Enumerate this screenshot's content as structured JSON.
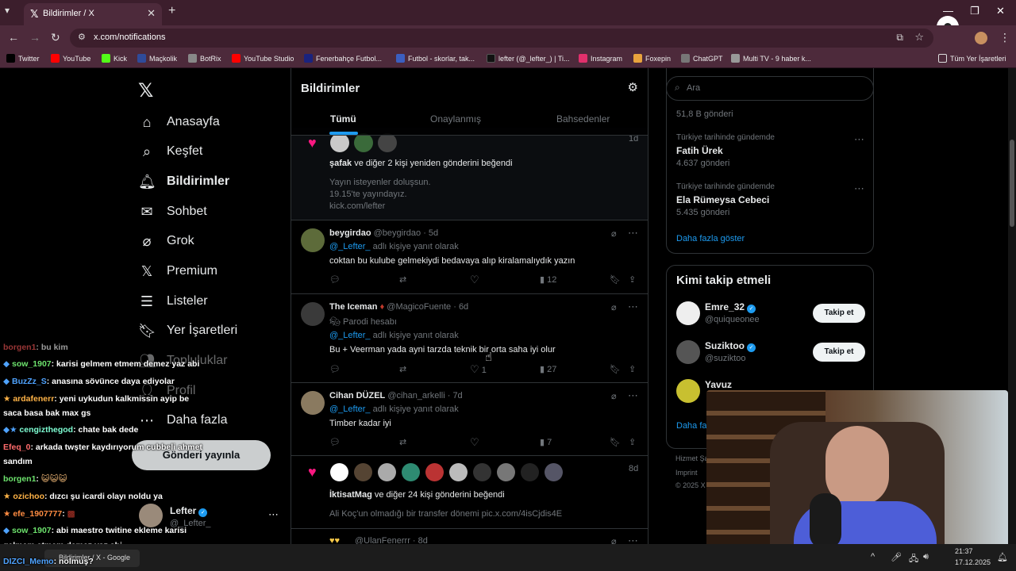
{
  "browser": {
    "tab_title": "Bildirimler / X",
    "url": "x.com/notifications",
    "bookmarks": [
      "Twitter",
      "YouTube",
      "Kick",
      "Maçkolik",
      "BotRix",
      "YouTube Studio",
      "Fenerbahçe Futbol...",
      "Futbol - skorlar, tak...",
      "lefter (@_lefter_) | Ti...",
      "Instagram",
      "Foxepin",
      "ChatGPT",
      "Multi TV - 9 haber k..."
    ],
    "all_bookmarks": "Tüm Yer İşaretleri"
  },
  "nav": {
    "items": [
      {
        "label": "Anasayfa",
        "icon": "home-icon"
      },
      {
        "label": "Keşfet",
        "icon": "search-icon"
      },
      {
        "label": "Bildirimler",
        "icon": "bell-icon"
      },
      {
        "label": "Sohbet",
        "icon": "mail-icon"
      },
      {
        "label": "Grok",
        "icon": "grok-icon"
      },
      {
        "label": "Premium",
        "icon": "x-icon"
      },
      {
        "label": "Listeler",
        "icon": "list-icon"
      },
      {
        "label": "Yer İşaretleri",
        "icon": "bookmark-icon"
      },
      {
        "label": "Topluluklar",
        "icon": "people-icon"
      },
      {
        "label": "Profil",
        "icon": "user-icon"
      },
      {
        "label": "Daha fazla",
        "icon": "more-icon"
      }
    ],
    "post_button": "Gönderi yayınla",
    "account_name": "Lefter",
    "account_handle": "@_Lefter_"
  },
  "header": {
    "title": "Bildirimler",
    "tabs": [
      "Tümü",
      "Onaylanmış",
      "Bahsedenler"
    ]
  },
  "notifications": {
    "n1": {
      "time": "1d",
      "text_user": "şafak",
      "text_rest": " ve diğer 2 kişi yeniden gönderini beğendi",
      "preview1": "Yayın isteyenler doluşsun.",
      "preview2": "19.15'te yayındayız.",
      "preview3": "kick.com/lefter"
    },
    "n2": {
      "name": "beygirdao",
      "handle": "@beygirdao",
      "time": "· 5d",
      "reply_to": "@_Lefter_",
      "reply_suffix": " adlı kişiye yanıt olarak",
      "body": "coktan bu kulube gelmekiydi bedavaya alıp kiralamalıydık yazın",
      "views": "12"
    },
    "n3": {
      "name": "The Iceman",
      "handle": "@MagicoFuente",
      "time": "· 6d",
      "parody": "Parodi hesabı",
      "reply_to": "@_Lefter_",
      "reply_suffix": " adlı kişiye yanıt olarak",
      "body": "Bu + Veerman yada ayni tarzda teknik bir orta saha iyi olur",
      "likes": "1",
      "views": "27"
    },
    "n4": {
      "name": "Cihan DÜZEL",
      "handle": "@cihan_arkelli",
      "time": "· 7d",
      "reply_to": "@_Lefter_",
      "reply_suffix": " adlı kişiye yanıt olarak",
      "body": "Timber kadar iyi",
      "views": "7"
    },
    "n5": {
      "time": "8d",
      "text_user": "İktisatMag",
      "text_rest": " ve diğer 24 kişi gönderini beğendi",
      "preview": "Ali Koç'un olmadığı bir transfer dönemi pic.x.com/4isCjdis4E"
    },
    "n6": {
      "handle": "@UlanFenerrr",
      "time": "· 8d"
    }
  },
  "search": {
    "placeholder": "Ara"
  },
  "trends": {
    "top_count": "51,8 B gönderi",
    "items": [
      {
        "context": "Türkiye tarihinde gündemde",
        "name": "Fatih Ürek",
        "count": "4.637 gönderi"
      },
      {
        "context": "Türkiye tarihinde gündemde",
        "name": "Ela Rümeysa Cebeci",
        "count": "5.435 gönderi"
      }
    ],
    "show_more": "Daha fazla göster"
  },
  "who_to_follow": {
    "title": "Kimi takip etmeli",
    "users": [
      {
        "name": "Emre_32",
        "handle": "@quiqueonee",
        "button": "Takip et"
      },
      {
        "name": "Suziktoo",
        "handle": "@suziktoo",
        "button": "Takip et"
      },
      {
        "name": "Yavuz",
        "handle": "",
        "button": ""
      }
    ],
    "show_more": "Daha fa"
  },
  "footer": [
    "Hizmet Şar",
    "Imprint",
    "© 2025 X C"
  ],
  "chat": [
    {
      "user": "borgen1",
      "msg": ": bu kim",
      "color": "#ff5a5a"
    },
    {
      "user": "sow_1907",
      "msg": ": karisi gelmem etmem demez yaz abi",
      "color": "#6de36d"
    },
    {
      "user": "BuzZz_S",
      "msg": ": anasına sövünce daya ediyolar",
      "color": "#4fa3ff"
    },
    {
      "user": "ardafenerr",
      "msg": ": yeni uykudun kalkmissin ayip be",
      "color": "#ffb347"
    },
    {
      "user": "",
      "msg": "saca basa bak max gs",
      "color": "#fff"
    },
    {
      "user": "cengizthegod",
      "msg": ": chate bak dede",
      "color": "#7fffd4"
    },
    {
      "user": "Efeq_0",
      "msg": ": arkada twşter kaydırıyorum cubbeli ahmet",
      "color": "#ff6b6b"
    },
    {
      "user": "",
      "msg": "sandım",
      "color": "#fff"
    },
    {
      "user": "borgen1",
      "msg": ":",
      "color": "#6de36d"
    },
    {
      "user": "ozichoo",
      "msg": ": dızcı şu icardi olayı noldu ya",
      "color": "#ffb347"
    },
    {
      "user": "efe_1907777",
      "msg": ":",
      "color": "#ff8c42"
    },
    {
      "user": "sow_1907",
      "msg": ": abi maestro twitine ekleme karisi",
      "color": "#6de36d"
    },
    {
      "user": "",
      "msg": "gelmem etmem demez yaz abi",
      "color": "#fff"
    },
    {
      "user": "DIZCI_Memo",
      "msg": ": nolmuş?",
      "color": "#4fa3ff"
    }
  ],
  "taskbar": {
    "item1": "Bildirimler / X - Google",
    "time": "21:37",
    "date": "17.12.2025"
  }
}
